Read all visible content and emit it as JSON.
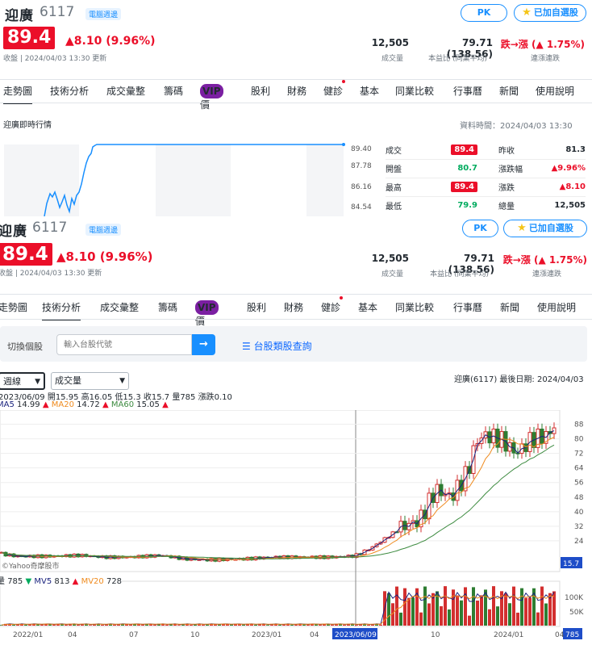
{
  "header": {
    "name": "迎廣",
    "code": "6117",
    "badge": "電腦週邊",
    "pk_label": "PK",
    "watch_label": "已加自選股",
    "price": "89.4",
    "change": "8.10 (9.96%)",
    "status": "收盤 | 2024/04/03 13:30 更新",
    "volume_value": "12,505",
    "volume_label": "成交量",
    "pe_value": "79.71 (138.56)",
    "pe_label": "本益比 (同業平均)",
    "streak_value_prefix": "跌→漲",
    "streak_value": "1.75%",
    "streak_label": "連漲連跌"
  },
  "tabs": [
    "走勢圖",
    "技術分析",
    "成交彙整",
    "籌碼",
    "估價",
    "股利",
    "財務",
    "健診",
    "基本",
    "同業比較",
    "行事曆",
    "新聞",
    "使用說明"
  ],
  "vip_label": "VIP",
  "intraday": {
    "title": "迎廣即時行情",
    "time": "資料時間：2024/04/03 13:30",
    "y_ticks": [
      "89.40",
      "87.78",
      "86.16",
      "84.54"
    ],
    "quote": [
      {
        "l1": "成交",
        "v1": "89.4",
        "l2": "昨收",
        "v2": "81.3"
      },
      {
        "l1": "開盤",
        "v1": "80.7",
        "l2": "漲跌幅",
        "v2": "9.96%"
      },
      {
        "l1": "最高",
        "v1": "89.4",
        "l2": "漲跌",
        "v2": "8.10"
      },
      {
        "l1": "最低",
        "v1": "79.9",
        "l2": "總量",
        "v2": "12,505"
      }
    ]
  },
  "search": {
    "label": "切換個股",
    "placeholder": "輸入台股代號",
    "category_link": "台股類股查詢"
  },
  "tech": {
    "period_select": "週線",
    "indicator_select": "成交量",
    "right_info": "迎廣(6117)   最後日期: 2024/04/03",
    "ohlc_line": "2023/06/09 開15.95 高16.05 低15.3 收15.7 量785 漲跌0.10",
    "ma5_label": "MA5",
    "ma5_value": "14.99",
    "ma20_label": "MA20",
    "ma20_value": "14.72",
    "ma60_label": "MA60",
    "ma60_value": "15.05",
    "watermark": "©Yahoo奇摩股市",
    "current_price_tag": "15.7",
    "vol_line_label": "量",
    "vol_value": "785",
    "mv5_label": "MV5",
    "mv5_value": "813",
    "mv20_label": "MV20",
    "mv20_value": "728",
    "vol_axis": [
      "100K",
      "50K"
    ],
    "vol_tag": "785",
    "cursor_date": "2023/06/09",
    "x_axis": [
      "2022/01",
      "04",
      "07",
      "10",
      "2023/01",
      "04",
      "2023/06/09",
      "10",
      "2024/01",
      "04"
    ]
  },
  "chart_data": {
    "type": "line",
    "title": "",
    "y_ticks": [
      88,
      80,
      72,
      64,
      56,
      48,
      40,
      32,
      24
    ],
    "price_series_weekly_close_approx": [
      {
        "x": "2022/01",
        "y": 17
      },
      {
        "x": "2022/04",
        "y": 16
      },
      {
        "x": "2022/07",
        "y": 16
      },
      {
        "x": "2022/10",
        "y": 14
      },
      {
        "x": "2023/01",
        "y": 15
      },
      {
        "x": "2023/04",
        "y": 15
      },
      {
        "x": "2023/06/09",
        "y": 15.7
      },
      {
        "x": "2023/08",
        "y": 24
      },
      {
        "x": "2023/10",
        "y": 50
      },
      {
        "x": "2023/12",
        "y": 82
      },
      {
        "x": "2024/01",
        "y": 80
      },
      {
        "x": "2024/04",
        "y": 89.4
      }
    ],
    "colors": {
      "up": "#d32f2f",
      "down": "#2e7d32",
      "ma5": "#1a237e",
      "ma20": "#ef8b1f",
      "ma60": "#3d8b40"
    }
  },
  "colors": {
    "accent": "#188fff",
    "up": "#eb0f29",
    "down": "#00ab5e"
  }
}
